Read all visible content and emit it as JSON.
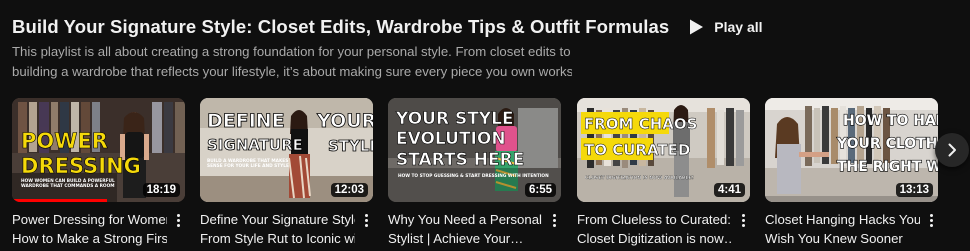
{
  "playlist": {
    "title": "Build Your Signature Style: Closet Edits, Wardrobe Tips & Outfit Formulas",
    "play_all_label": "Play all",
    "description_line1": "This playlist is all about creating a strong foundation for your personal style. From closet edits to",
    "description_line2": "building a wardrobe that reflects your lifestyle, it’s about making sure every piece you own works…"
  },
  "videos": [
    {
      "title_line1": "Power Dressing for Women |",
      "title_line2": "How to Make a Strong First…",
      "duration": "18:19",
      "watched_fraction": 0.55,
      "thumb_text": [
        "POWER",
        "DRESSING"
      ],
      "thumb_subtext": [
        "HOW WOMEN CAN BUILD A POWERFUL",
        "WARDROBE THAT COMMANDS A ROOM"
      ]
    },
    {
      "title_line1": "Define Your Signature Style |",
      "title_line2": "From Style Rut to Iconic wit…",
      "duration": "12:03",
      "watched_fraction": 0.0,
      "thumb_text": [
        "DEFINE",
        "SIGNATURE",
        "YOUR",
        "STYLE"
      ],
      "thumb_subtext": [
        "BUILD A WARDROBE THAT MAKES",
        "SENSE FOR YOUR LIFE AND STYLE"
      ]
    },
    {
      "title_line1": "Why You Need a Personal",
      "title_line2": "Stylist | Achieve Your…",
      "duration": "6:55",
      "watched_fraction": 0.0,
      "thumb_text": [
        "YOUR STYLE",
        "EVOLUTION",
        "STARTS HERE"
      ],
      "thumb_subtext": [
        "HOW TO STOP GUESSING & START DRESSING WITH INTENTION"
      ]
    },
    {
      "title_line1": "From Clueless to Curated:",
      "title_line2": "Closet Digitization is now…",
      "duration": "4:41",
      "watched_fraction": 0.0,
      "thumb_text": [
        "FROM CHAOS",
        "TO CURATED"
      ],
      "thumb_subtext": [
        "CLOSET DIGITIZATION IS NOW AVAILABLE!"
      ]
    },
    {
      "title_line1": "Closet Hanging Hacks You’ll",
      "title_line2": "Wish You Knew Sooner",
      "duration": "13:13",
      "watched_fraction": 0.0,
      "thumb_text": [
        "HOW TO HANG",
        "YOUR CLOTHES",
        "THE RIGHT WAY"
      ],
      "thumb_subtext": []
    }
  ],
  "icons": {
    "play_all": "play-icon",
    "more": "more-vert-icon",
    "next": "chevron-right-icon"
  },
  "colors": {
    "background": "#0f0f0f",
    "thumb_text_yellow": "#f5d90a",
    "progress_red": "#ff0000"
  }
}
